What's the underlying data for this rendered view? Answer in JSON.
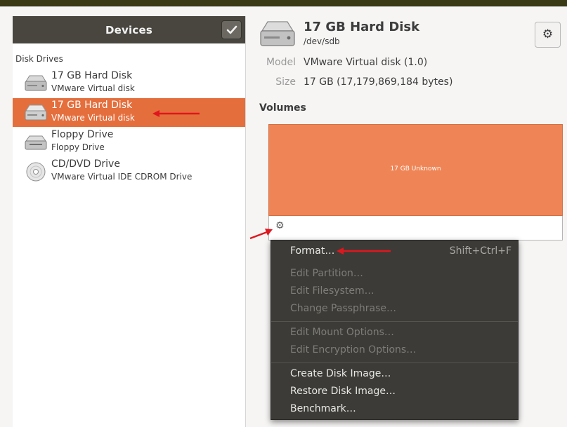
{
  "sidebar": {
    "title": "Devices",
    "section_label": "Disk Drives",
    "devices": [
      {
        "name": "17 GB Hard Disk",
        "subtitle": "VMware Virtual disk",
        "icon": "hard-disk-icon",
        "selected": false
      },
      {
        "name": "17 GB Hard Disk",
        "subtitle": "VMware Virtual disk",
        "icon": "hard-disk-icon",
        "selected": true
      },
      {
        "name": "Floppy Drive",
        "subtitle": "Floppy Drive",
        "icon": "floppy-drive-icon",
        "selected": false
      },
      {
        "name": "CD/DVD Drive",
        "subtitle": "VMware Virtual IDE CDROM Drive",
        "icon": "optical-disc-icon",
        "selected": false
      }
    ]
  },
  "disk": {
    "title": "17 GB Hard Disk",
    "path": "/dev/sdb",
    "model_label": "Model",
    "model_value": "VMware Virtual disk (1.0)",
    "size_label": "Size",
    "size_value": "17 GB (17,179,869,184 bytes)",
    "volumes_label": "Volumes",
    "volume_text": "17 GB Unknown"
  },
  "menu": {
    "items": [
      {
        "label": "Format…",
        "shortcut": "Shift+Ctrl+F",
        "enabled": true
      },
      {
        "label": "Edit Partition…",
        "enabled": false
      },
      {
        "label": "Edit Filesystem…",
        "enabled": false
      },
      {
        "label": "Change Passphrase…",
        "enabled": false
      },
      {
        "label": "Edit Mount Options…",
        "enabled": false
      },
      {
        "label": "Edit Encryption Options…",
        "enabled": false
      },
      {
        "label": "Create Disk Image…",
        "enabled": true
      },
      {
        "label": "Restore Disk Image…",
        "enabled": true
      },
      {
        "label": "Benchmark…",
        "enabled": true
      }
    ]
  },
  "colors": {
    "accent": "#e46e3c",
    "volume": "#ef8556",
    "annotation_arrow": "#e0161e",
    "menu_bg": "#3c3b37"
  }
}
